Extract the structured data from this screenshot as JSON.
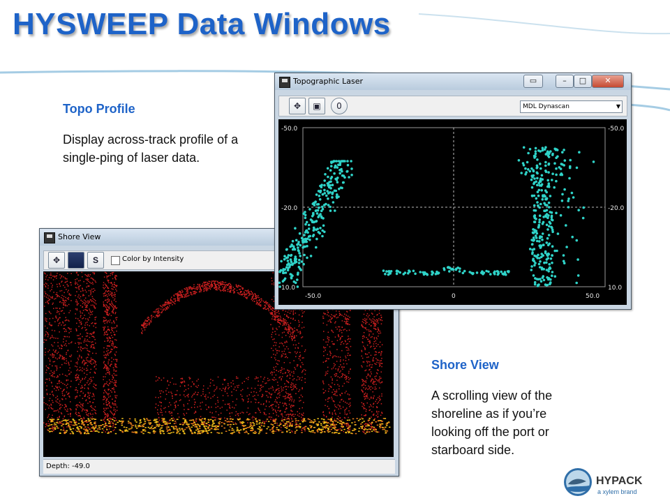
{
  "slide": {
    "title": "HYSWEEP Data Windows"
  },
  "topo_text": {
    "heading": "Topo Profile",
    "body": "Display across-track profile of a single-ping of laser data."
  },
  "shore_text": {
    "heading": "Shore View",
    "body": "A scrolling view of the shoreline as if you’re looking off the port or starboard side."
  },
  "topo_window": {
    "title": "Topographic Laser",
    "toolbar": {
      "pan_icon": "move-arrows-icon",
      "save_icon": "disk-icon",
      "zero_label": "0",
      "device_select": "MDL Dynascan"
    },
    "window_buttons": {
      "restore": "▭",
      "maximize": "□",
      "close": "✕"
    },
    "plot": {
      "left_top": "-50.0",
      "left_mid": "-20.0",
      "left_bottom": "10.0",
      "right_top": "-50.0",
      "right_mid": "-20.0",
      "right_bottom": "10.0",
      "bottom_left": "-50.0",
      "bottom_center": "0",
      "bottom_right": "50.0"
    },
    "point_color": "#2fd3c8"
  },
  "shore_window": {
    "title": "Shore View",
    "toolbar": {
      "pan_icon": "move-arrows-icon",
      "palette_icon": "grid-palette-icon",
      "s_label": "S",
      "checkbox_label": "Color by Intensity"
    },
    "status": "Depth: -49.0",
    "colors": {
      "points": "#d02020",
      "band": "#f3c21a"
    }
  },
  "logo": {
    "name": "HYPACK",
    "tagline": "a xylem brand"
  },
  "colors": {
    "accent": "#1e63c8"
  }
}
